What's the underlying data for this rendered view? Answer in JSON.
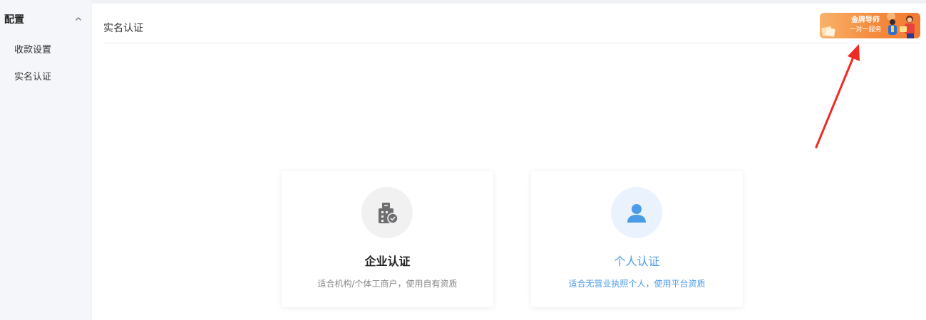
{
  "sidebar": {
    "title": "配置",
    "items": [
      {
        "label": "收款设置"
      },
      {
        "label": "实名认证"
      }
    ]
  },
  "main": {
    "page_title": "实名认证",
    "banner": {
      "line1": "金牌导师",
      "line2": "一对一服务"
    },
    "cards": [
      {
        "title": "企业认证",
        "description": "适合机构/个体工商户，使用自有资质",
        "icon": "building-verified-icon"
      },
      {
        "title": "个人认证",
        "description": "适合无营业执照个人，使用平台资质",
        "icon": "person-icon"
      }
    ]
  },
  "colors": {
    "accent": "#4a9be8",
    "annotation_arrow": "#ee2b24",
    "banner": "#f58a3c"
  }
}
